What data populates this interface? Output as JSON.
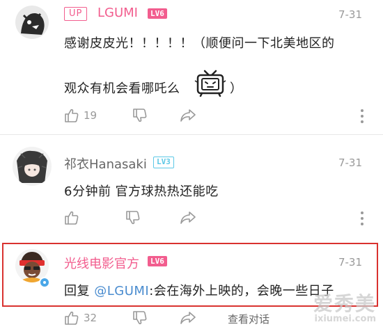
{
  "comments": [
    {
      "up_badge": "UP",
      "username": "LGUMI",
      "level": "LV6",
      "date": "7-31",
      "text_line1": "感谢皮皮光！！！！！（顺便问一下北美地区的",
      "text_line2": "观众有机会看哪吒么",
      "text_close": "）",
      "like_count": "19"
    },
    {
      "username": "祁衣Hanasaki",
      "level": "LV3",
      "date": "7-31",
      "text": "6分钟前 官方球热热还能吃",
      "like_count": ""
    },
    {
      "username": "光线电影官方",
      "level": "LV6",
      "date": "7-31",
      "reply_prefix": "回复 ",
      "mention": "@LGUMI",
      "text": ":会在海外上映的，会晚一些日子",
      "like_count": "32",
      "view_dialog": "查看对话"
    }
  ],
  "colors": {
    "pink": "#f25d8e",
    "blue": "#5cc8e6",
    "link": "#4a8ccf",
    "highlight": "#d9322f"
  },
  "watermark": {
    "cn": "爱秀美",
    "en": "ixiumei.com"
  }
}
